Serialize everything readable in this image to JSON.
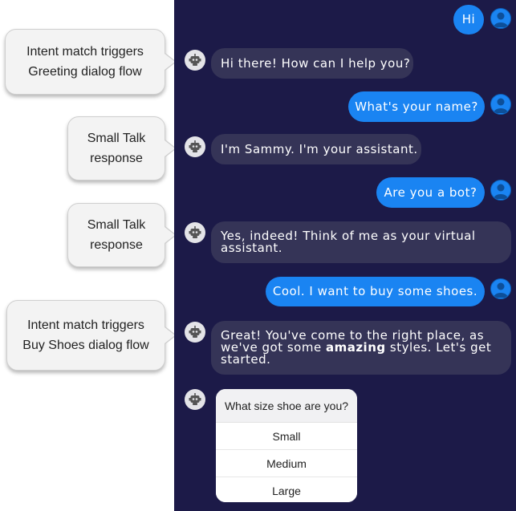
{
  "annotations": [
    {
      "lines": [
        "Intent match triggers",
        "Greeting dialog flow"
      ]
    },
    {
      "lines": [
        "Small Talk",
        "response"
      ]
    },
    {
      "lines": [
        "Small Talk",
        "response"
      ]
    },
    {
      "lines": [
        "Intent match triggers",
        "Buy Shoes dialog flow"
      ]
    }
  ],
  "chat": {
    "messages": [
      {
        "from": "user",
        "text": "Hi"
      },
      {
        "from": "bot",
        "text": "Hi there! How can I help you?"
      },
      {
        "from": "user",
        "text": "What's your name?"
      },
      {
        "from": "bot",
        "text": "I'm Sammy. I'm your assistant."
      },
      {
        "from": "user",
        "text": "Are you a bot?"
      },
      {
        "from": "bot",
        "lines": [
          "Yes, indeed! Think of me as your virtual",
          "assistant."
        ]
      },
      {
        "from": "user",
        "text": "Cool. I want to buy some shoes."
      },
      {
        "from": "bot",
        "line1": "Great! You've come to the right place, as",
        "line2_pre": "we've got some ",
        "line2_bold": "amazing",
        "line2_post": " styles. Let's get",
        "line3": "started."
      }
    ],
    "quick_reply": {
      "prompt": "What size shoe are you?",
      "options": [
        "Small",
        "Medium",
        "Large"
      ]
    }
  },
  "icons": {
    "bot": "robot-icon",
    "user": "user-avatar-icon"
  },
  "colors": {
    "chat_background": "#1c1a48",
    "user_bubble": "#1a84f2",
    "bot_bubble": "#353457",
    "callout_fill": "#f3f3f3"
  }
}
